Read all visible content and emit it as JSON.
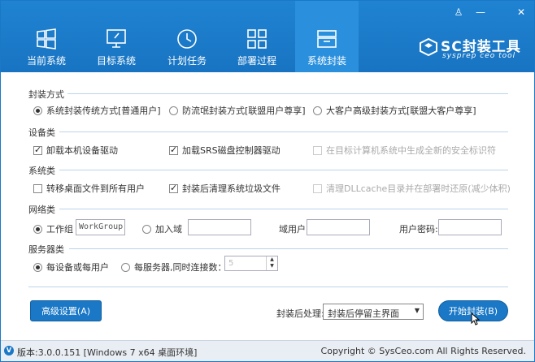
{
  "window_controls": {
    "user": "♙",
    "min": "—",
    "close": "✕"
  },
  "tabs": [
    {
      "label": "当前系统",
      "icon": "windows-icon"
    },
    {
      "label": "目标系统",
      "icon": "monitor-icon"
    },
    {
      "label": "计划任务",
      "icon": "clock-icon"
    },
    {
      "label": "部署过程",
      "icon": "grid-icon"
    },
    {
      "label": "系统封装",
      "icon": "package-icon",
      "active": true
    }
  ],
  "logo": {
    "title": "SC封装工具",
    "subtitle": "sysprep ceo tool"
  },
  "sections": {
    "mode": {
      "title": "封装方式",
      "options": [
        {
          "label": "系统封装传统方式[普通用户]",
          "checked": true
        },
        {
          "label": "防流氓封装方式[联盟用户尊享]",
          "checked": false
        },
        {
          "label": "大客户高级封装方式[联盟大客户尊享]",
          "checked": false
        }
      ]
    },
    "devices": {
      "title": "设备类",
      "options": [
        {
          "label": "卸载本机设备驱动",
          "checked": true
        },
        {
          "label": "加载SRS磁盘控制器驱动",
          "checked": true
        },
        {
          "label": "在目标计算机系统中生成全新的安全标识符",
          "checked": false,
          "disabled": true
        }
      ]
    },
    "system": {
      "title": "系统类",
      "options": [
        {
          "label": "转移桌面文件到所有用户",
          "checked": false
        },
        {
          "label": "封装后清理系统垃圾文件",
          "checked": true
        },
        {
          "label": "清理DLLcache目录并在部署时还原(减少体积)",
          "checked": false,
          "disabled": true
        }
      ]
    },
    "network": {
      "title": "网络类",
      "workgroup_label": "工作组",
      "workgroup_value": "WorkGroup",
      "domain_label": "加入域",
      "domain_user_label": "域用户:",
      "user_password_label": "用户密码:"
    },
    "server": {
      "title": "服务器类",
      "per_device_label": "每设备或每用户",
      "per_server_label": "每服务器,同时连接数：",
      "connections_value": "5"
    }
  },
  "bottom": {
    "advanced_label": "高级设置(A)",
    "after_label": "封装后处理:",
    "after_value": "封装后停留主界面",
    "start_label": "开始封装(B)"
  },
  "footer": {
    "version": "版本:3.0.0.151 [Windows 7 x64 桌面环境]",
    "copyright": "Copyright © SysCeo.com All Rights Reserved."
  }
}
